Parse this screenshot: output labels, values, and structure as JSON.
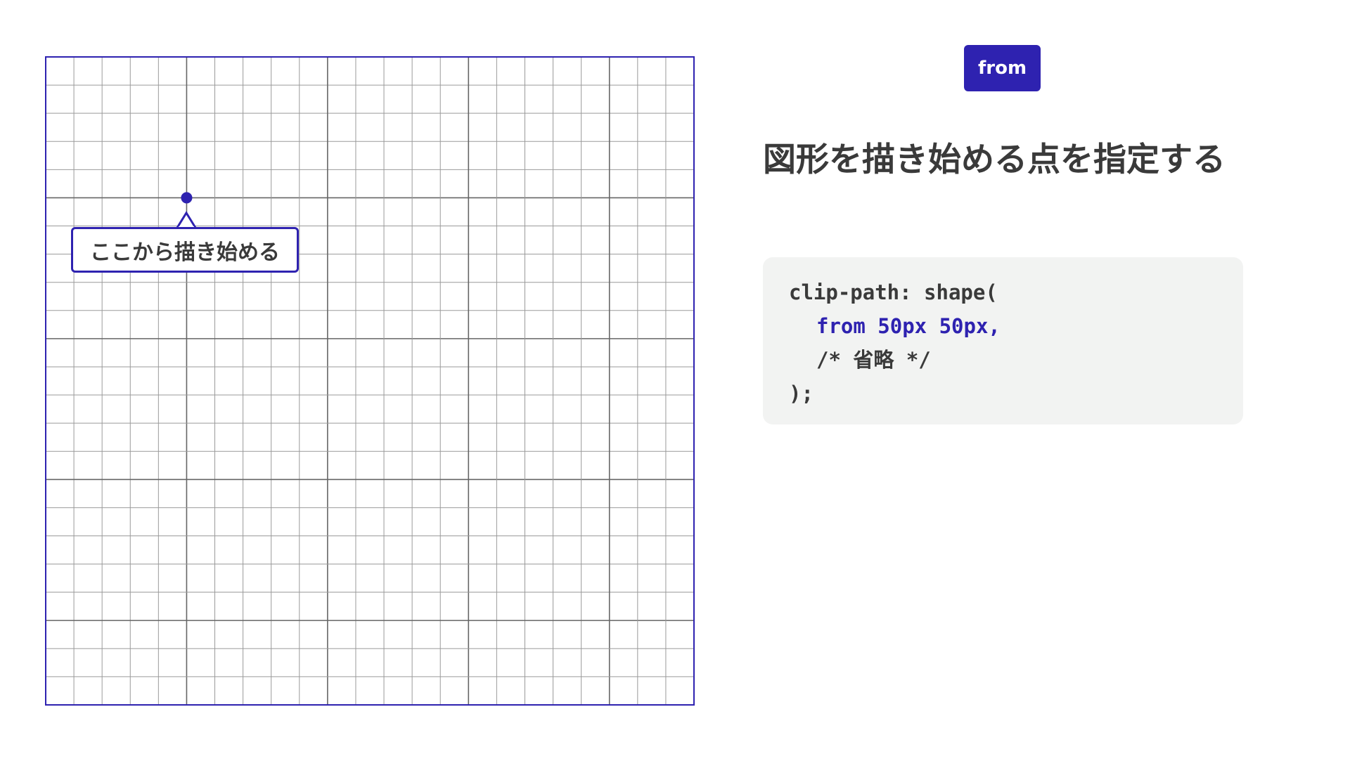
{
  "badge": {
    "label": "from"
  },
  "heading": "図形を描き始める点を指定する",
  "callout": {
    "label": "ここから描き始める"
  },
  "code": {
    "line1": "clip-path: shape(",
    "line2": "from 50px 50px,",
    "line3": "/* 省略 */",
    "line4": ");"
  },
  "colors": {
    "accent": "#2e22b0",
    "text": "#3a3a3a",
    "code_bg": "#f2f3f2",
    "grid_minor": "#9a9a9a",
    "grid_major": "#666666"
  },
  "diagram": {
    "grid_cells": 23,
    "major_every": 5,
    "start_point": {
      "x": 50,
      "y": 50
    }
  }
}
